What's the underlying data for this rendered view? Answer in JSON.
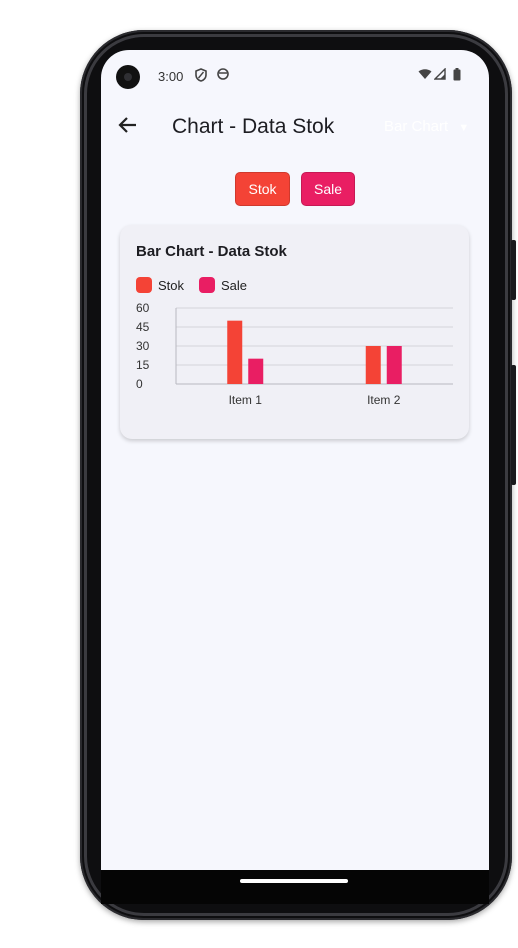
{
  "status": {
    "time": "3:00",
    "left_icons": [
      "shield-icon",
      "face-icon"
    ],
    "right_icons": [
      "wifi-icon",
      "signal-icon",
      "battery-icon"
    ]
  },
  "appbar": {
    "back_icon": "arrow-left-icon",
    "title": "Chart - Data Stok",
    "dropdown_value": "Bar Chart",
    "dropdown_icon": "caret-down-icon"
  },
  "buttons": {
    "stok": "Stok",
    "sale": "Sale"
  },
  "colors": {
    "stok": "#f44336",
    "sale": "#e91e63",
    "primary_text": "#1d1d22"
  },
  "card": {
    "title": "Bar Chart - Data Stok",
    "legend": [
      "Stok",
      "Sale"
    ]
  },
  "chart_data": {
    "type": "bar",
    "title": "Bar Chart - Data Stok",
    "categories": [
      "Item 1",
      "Item 2"
    ],
    "series": [
      {
        "name": "Stok",
        "values": [
          50,
          30
        ]
      },
      {
        "name": "Sale",
        "values": [
          20,
          30
        ]
      }
    ],
    "y_ticks": [
      "60",
      "45",
      "30",
      "15",
      "0"
    ],
    "ylim": [
      0,
      60
    ],
    "grid": true,
    "legend_position": "top-left"
  }
}
